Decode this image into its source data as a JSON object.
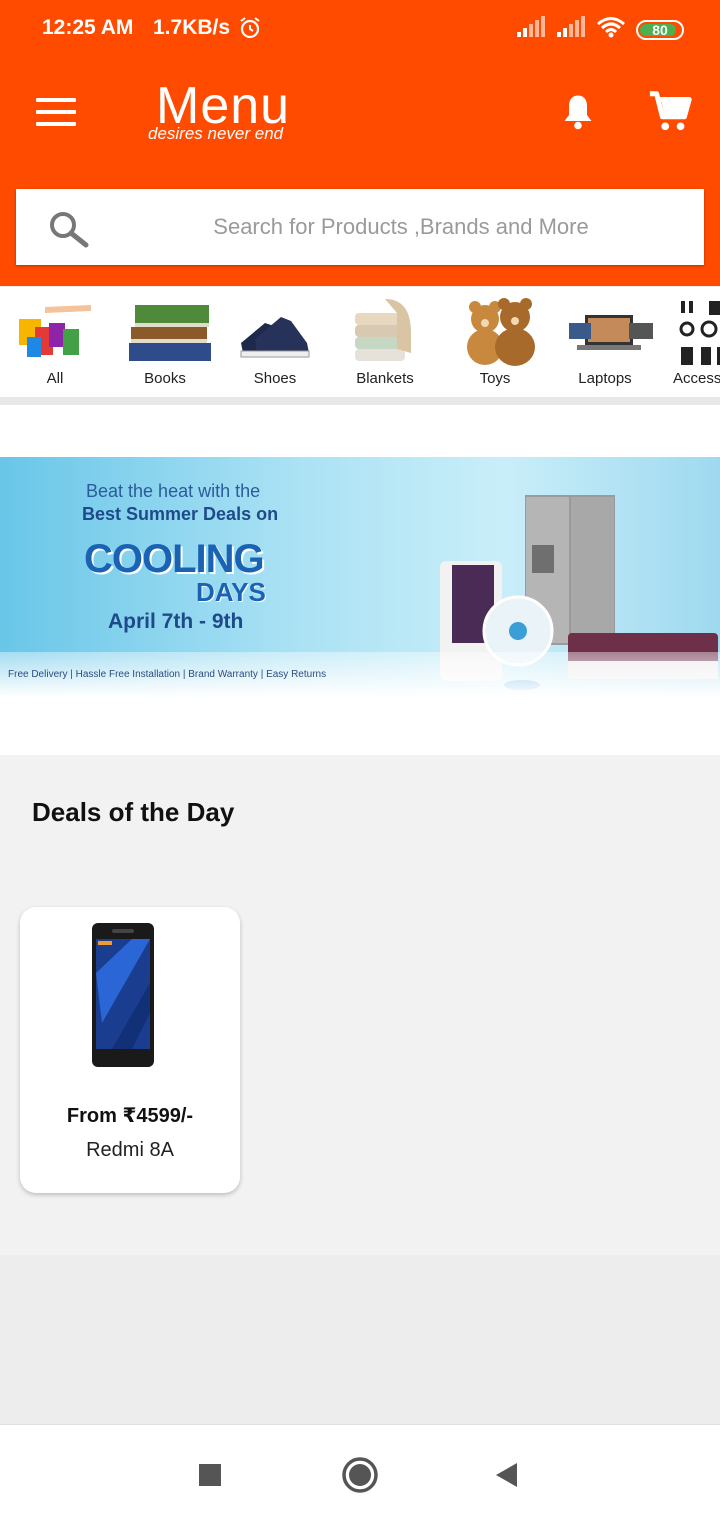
{
  "status_bar": {
    "time": "12:25 AM",
    "speed": "1.7KB/s",
    "battery": "80"
  },
  "app_bar": {
    "logo_main": "Menu",
    "logo_tagline": "desires never end"
  },
  "search": {
    "placeholder": "Search for Products ,Brands and More"
  },
  "categories": [
    {
      "label": "All"
    },
    {
      "label": "Books"
    },
    {
      "label": "Shoes"
    },
    {
      "label": "Blankets"
    },
    {
      "label": "Toys"
    },
    {
      "label": "Laptops"
    },
    {
      "label": "Accessories"
    }
  ],
  "banner": {
    "line1": "Beat the heat with the",
    "line2": "Best Summer Deals on",
    "headline": "COOLING",
    "headline2": "DAYS",
    "dates": "April 7th - 9th",
    "footer": "Free Delivery | Hassle Free Installation | Brand Warranty | Easy Returns"
  },
  "deals": {
    "title": "Deals of the Day",
    "items": [
      {
        "price": "From ₹4599/-",
        "name": "Redmi 8A"
      }
    ]
  },
  "colors": {
    "brand": "#ff4b00",
    "battery": "#4caf50"
  }
}
